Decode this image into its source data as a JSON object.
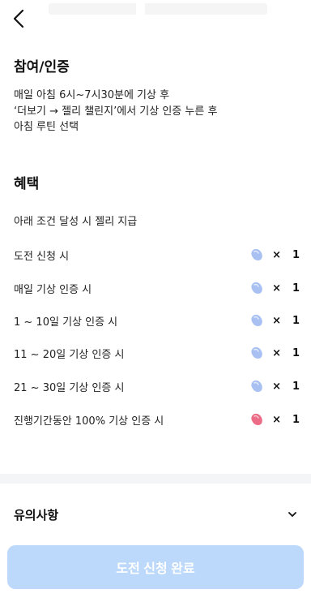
{
  "participation": {
    "title": "참여/인증",
    "lines": [
      "매일 아침 6시~7시30분에 기상 후",
      "‘더보기 → 젤리 챌린지’에서 기상 인증 누른 후",
      "아침 루틴 선택"
    ]
  },
  "benefits": {
    "title": "혜택",
    "intro": "아래 조건 달성 시 젤리 지급",
    "rows": [
      {
        "label": "도전 신청 시",
        "times": "×",
        "count": "1",
        "jelly": "blue-jelly-icon",
        "color": "#a9c1f2"
      },
      {
        "label": "매일 기상 인증 시",
        "times": "×",
        "count": "1",
        "jelly": "blue-jelly-icon",
        "color": "#a9c1f2"
      },
      {
        "label": "1 ~ 10일 기상 인증 시",
        "times": "×",
        "count": "1",
        "jelly": "blue-jelly-icon",
        "color": "#a9c1f2"
      },
      {
        "label": "11 ~ 20일 기상 인증 시",
        "times": "×",
        "count": "1",
        "jelly": "blue-jelly-icon",
        "color": "#a9c1f2"
      },
      {
        "label": "21 ~ 30일 기상 인증 시",
        "times": "×",
        "count": "1",
        "jelly": "blue-jelly-icon",
        "color": "#a9c1f2"
      },
      {
        "label": "진행기간동안 100% 기상 인증 시",
        "times": "×",
        "count": "1",
        "jelly": "pink-jelly-icon",
        "color": "#ec6b86"
      }
    ]
  },
  "notice": {
    "label": "유의사항"
  },
  "cta": {
    "label": "도전 신청 완료"
  }
}
